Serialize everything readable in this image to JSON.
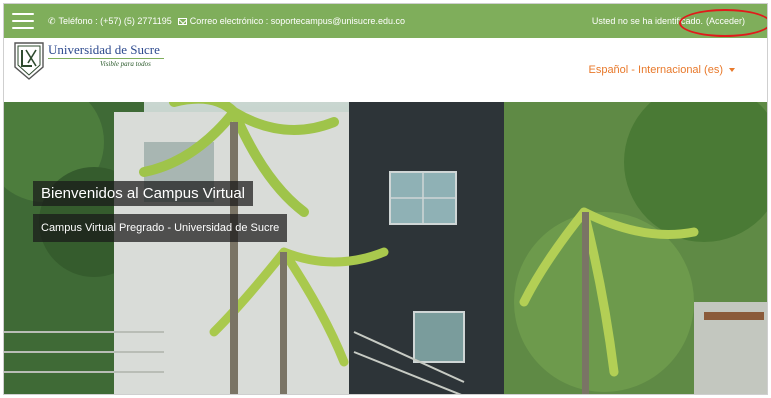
{
  "topbar": {
    "phone": "Teléfono : (+57) (5) 2771195",
    "email": "Correo electrónico : soportecampus@unisucre.edu.co",
    "login_status": "Usted no se ha identificado.",
    "login_link": "(Acceder)",
    "bg_color": "#7fae5b"
  },
  "header": {
    "brand_name": "Universidad de Sucre",
    "brand_tagline": "Visible para todos",
    "language": "Español - Internacional (es)",
    "language_color": "#e8792b"
  },
  "hero": {
    "welcome": "Bienvenidos al Campus Virtual",
    "subtitle": "Campus Virtual Pregrado - Universidad de Sucre"
  },
  "annotation": {
    "color": "#e01b1b",
    "target": "login-link"
  }
}
